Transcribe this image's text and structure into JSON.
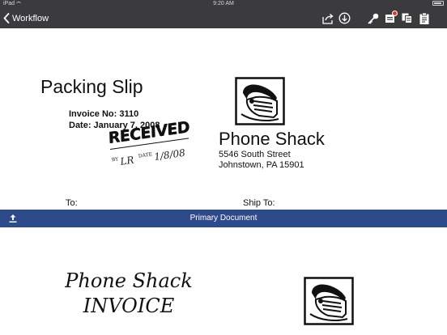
{
  "status_bar": {
    "carrier": "iPad",
    "time": "9:20 AM"
  },
  "nav": {
    "back_label": "Workflow",
    "icons": [
      "share-icon",
      "download-icon",
      "key-icon",
      "stamp-icon",
      "copy-icon",
      "clipboard-icon"
    ],
    "badge_color": "#d9382f",
    "bar_color": "#3b3b3d"
  },
  "document1": {
    "title": "Packing Slip",
    "invoice_no": "Invoice No: 3110",
    "date": "Date: January 7, 2008",
    "stamp": {
      "word": "RECEIVED",
      "by_label": "BY",
      "signature": "LR",
      "date_label": "DATE",
      "date_value": "1/8/08"
    },
    "company": "Phone Shack",
    "address_line1": "5546 South Street",
    "address_line2": "Johnstown, PA 15901",
    "to_label": "To:",
    "ship_to_label": "Ship To:"
  },
  "section_bar": {
    "title": "Primary Document",
    "color": "#2d4a8a"
  },
  "document2": {
    "company": "Phone Shack",
    "title": "INVOICE"
  }
}
